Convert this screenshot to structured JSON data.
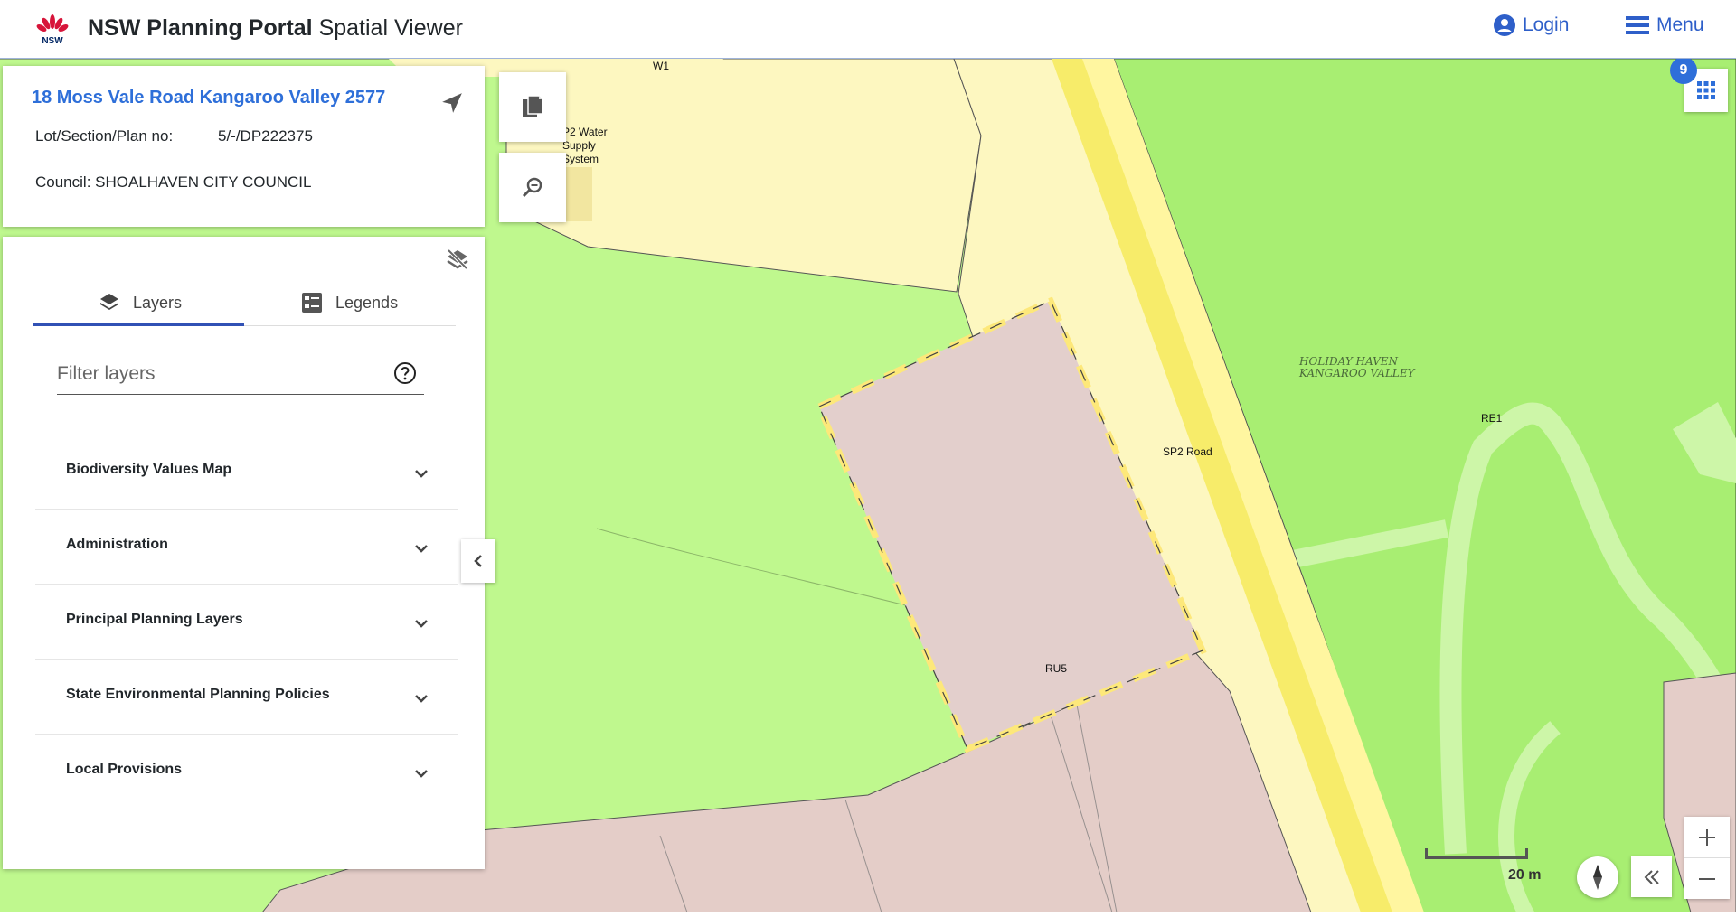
{
  "header": {
    "logo_text": "NSW",
    "brand_bold": "NSW Planning Portal",
    "brand_rest": " Spatial Viewer",
    "login_label": "Login",
    "menu_label": "Menu"
  },
  "property": {
    "address": "18 Moss Vale Road Kangaroo Valley 2577",
    "lot_label": "Lot/Section/Plan no:",
    "lot_value": "5/-/DP222375",
    "council": "Council: SHOALHAVEN CITY COUNCIL"
  },
  "panel": {
    "tabs": [
      {
        "label": "Layers",
        "icon": "layers-icon",
        "active": true
      },
      {
        "label": "Legends",
        "icon": "legend-icon",
        "active": false
      }
    ],
    "filter_placeholder": "Filter layers",
    "groups": [
      {
        "label": "Biodiversity Values Map"
      },
      {
        "label": "Administration"
      },
      {
        "label": "Principal Planning Layers"
      },
      {
        "label": "State Environmental Planning Policies"
      },
      {
        "label": "Local Provisions"
      }
    ]
  },
  "map": {
    "labels": {
      "w1": "W1",
      "sp2_water": [
        "P2 Water",
        "Supply",
        "System"
      ],
      "holiday_haven": [
        "HOLIDAY HAVEN",
        "KANGAROO VALLEY"
      ],
      "re1": "RE1",
      "sp2_road": "SP2 Road",
      "ru5": "RU5"
    },
    "layer_count": "9",
    "scale": "20 m"
  },
  "colors": {
    "accent": "#2e6fd9",
    "zone_green": "#bff88e",
    "zone_green_dark": "#a8ee72",
    "zone_yellow": "#fdf7c0",
    "zone_pink": "#e4cdc8",
    "road_yellow": "#f7ec6a"
  }
}
